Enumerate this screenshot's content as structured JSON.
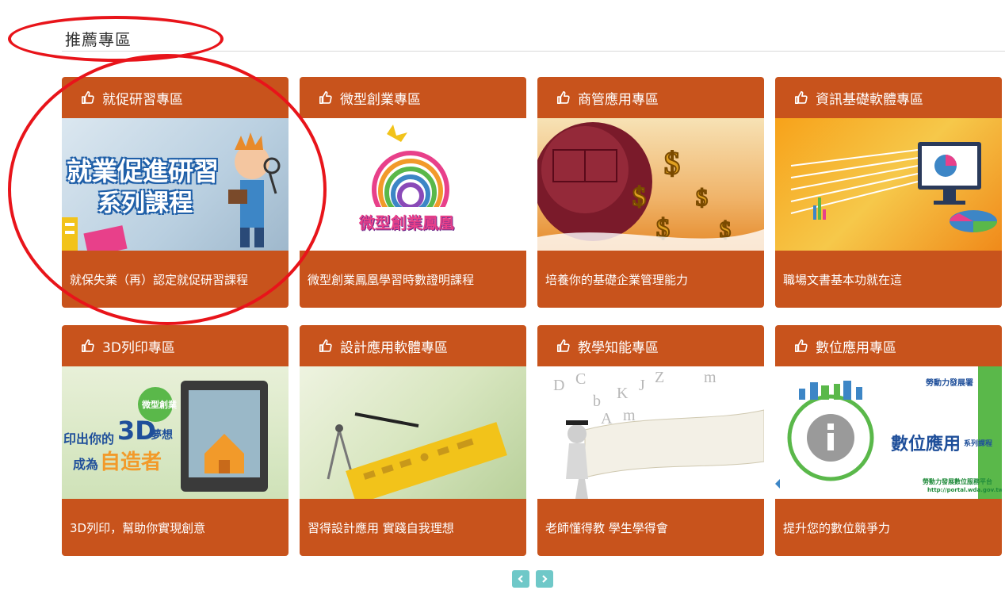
{
  "section": {
    "title": "推薦專區"
  },
  "cards": [
    {
      "title": "就促研習專區",
      "desc": "就保失業（再）認定就促研習課程",
      "image": {
        "line1": "就業促進研習",
        "line2": "系列課程"
      }
    },
    {
      "title": "微型創業專區",
      "desc": "微型創業鳳凰學習時數證明課程",
      "image": {
        "text": "微型創業鳳凰"
      }
    },
    {
      "title": "商管應用專區",
      "desc": "培養你的基礎企業管理能力",
      "image": {}
    },
    {
      "title": "資訊基礎軟體專區",
      "desc": "職場文書基本功就在這",
      "image": {}
    },
    {
      "title": "3D列印專區",
      "desc": "3D列印，幫助你實現創意",
      "image": {
        "bubble": "微型創業",
        "line1a": "印出你的",
        "line1b": "3D",
        "line1c": "夢想",
        "line2a": "成為",
        "line2b": "自造者"
      }
    },
    {
      "title": "設計應用軟體專區",
      "desc": "習得設計應用 實踐自我理想",
      "image": {}
    },
    {
      "title": "教學知能專區",
      "desc": "老師懂得教 學生學得會",
      "image": {}
    },
    {
      "title": "數位應用專區",
      "desc": "提升您的數位競爭力",
      "image": {
        "logo": "勞動力發展署",
        "main": "數位應用",
        "sub": "系列課程",
        "platform": "勞動力發展數位服務平台",
        "url": "http://portal.wda.gov.tw"
      }
    }
  ],
  "pager": {
    "prev": "‹",
    "next": "›"
  }
}
